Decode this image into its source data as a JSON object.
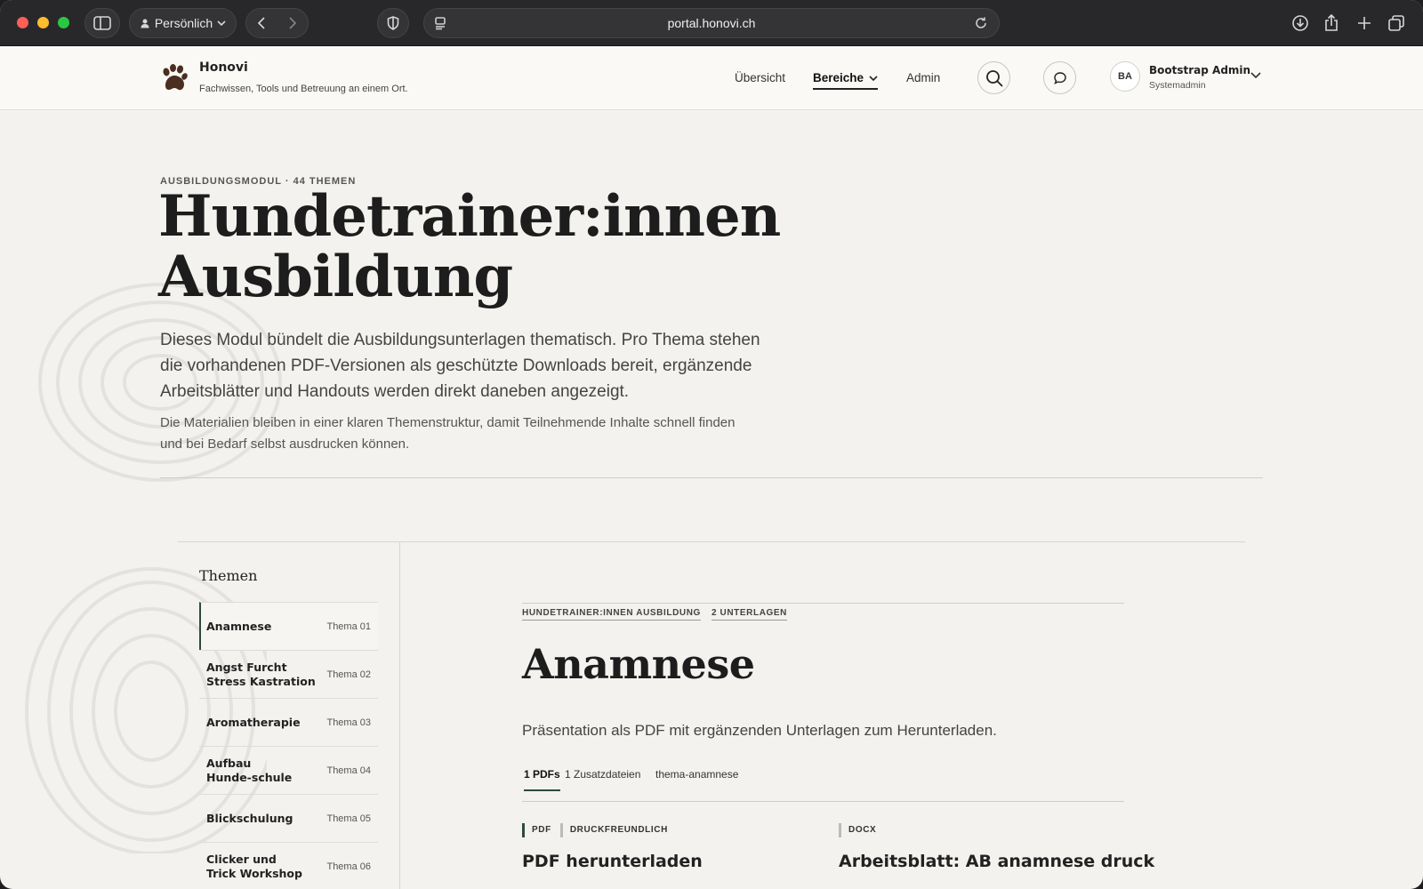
{
  "browser": {
    "profile_label": "Persönlich",
    "url": "portal.honovi.ch"
  },
  "site": {
    "brand": "Honovi",
    "tagline": "Fachwissen, Tools und Betreuung an einem Ort.",
    "nav": [
      "Übersicht",
      "Bereiche",
      "Admin"
    ],
    "user": {
      "initials": "BA",
      "name": "Bootstrap Admin",
      "role": "Systemadmin"
    }
  },
  "hero": {
    "eyebrow": "AUSBILDUNGSMODUL · 44 THEMEN",
    "title_line1": "Hundetrainer:innen",
    "title_line2": "Ausbildung",
    "lead": "Dieses Modul bündelt die Ausbildungsunterlagen thematisch. Pro Thema stehen die vorhandenen PDF-Versionen als geschützte Downloads bereit, ergänzende Arbeitsblätter und Handouts werden direkt daneben angezeigt.",
    "sub": "Die Materialien bleiben in einer klaren Themenstruktur, damit Teilnehmende Inhalte schnell finden und bei Bedarf selbst ausdrucken können."
  },
  "sidebar": {
    "title": "Themen",
    "items": [
      {
        "name": "Anamnese",
        "num": "Thema 01"
      },
      {
        "name": "Angst Furcht Stress Kastration",
        "num": "Thema 02"
      },
      {
        "name": "Aromatherapie",
        "num": "Thema 03"
      },
      {
        "name": "Aufbau Hunde-schule",
        "num": "Thema 04"
      },
      {
        "name": "Blickschulung",
        "num": "Thema 05"
      },
      {
        "name": "Clicker und Trick Workshop",
        "num": "Thema 06"
      }
    ]
  },
  "main": {
    "tag_module": "HUNDETRAINER:INNEN AUSBILDUNG",
    "tag_count": "2 UNTERLAGEN",
    "title": "Anamnese",
    "description": "Präsentation als PDF mit ergänzenden Unterlagen zum Herunterladen.",
    "tabs": [
      "1 PDFs",
      "1 Zusatzdateien",
      "thema-anamnese"
    ],
    "cards": [
      {
        "tags": [
          "PDF",
          "DRUCKFREUNDLICH"
        ],
        "title": "PDF herunterladen"
      },
      {
        "tags": [
          "DOCX"
        ],
        "title": "Arbeitsblatt: AB anamnese druck"
      }
    ]
  }
}
